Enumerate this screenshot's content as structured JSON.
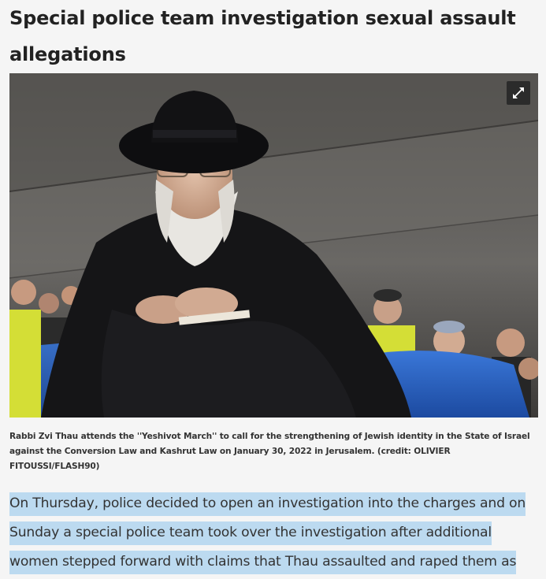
{
  "article": {
    "headline": "Special police team investigation sexual assault allegations",
    "image": {
      "description_icon": "photo",
      "expand_icon": "expand-arrows-icon"
    },
    "caption": "Rabbi Zvi Thau attends the ''Yeshivot March'' to call for the strengthening of Jewish identity in the State of Israel against the Conversion Law and Kashrut Law on January 30, 2022 in Jerusalem. (credit: OLIVIER FITOUSSI/FLASH90)",
    "paragraph": "On Thursday, police decided to open an investigation into the charges and on Sunday a special police team took over the investigation after additional women stepped forward with claims that Thau assaulted and raped them as well."
  },
  "colors": {
    "background": "#f5f5f5",
    "text": "#333333",
    "selection": "#bcdaf0",
    "vest": "#d8e63a",
    "seat": "#2a5fc0"
  }
}
